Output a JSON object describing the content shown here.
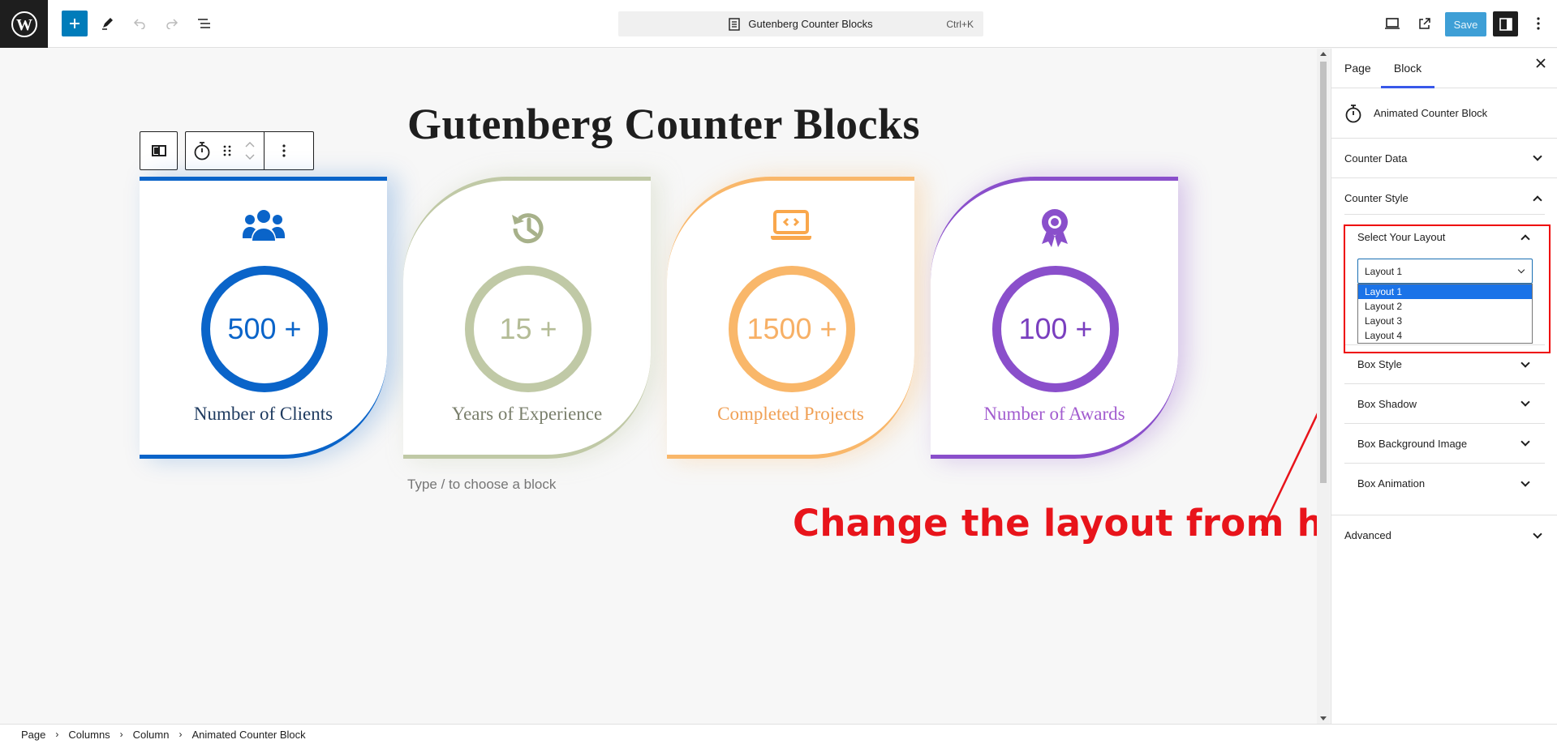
{
  "header": {
    "document_title": "Gutenberg Counter Blocks",
    "shortcut": "Ctrl+K",
    "save_label": "Save"
  },
  "canvas": {
    "title": "Gutenberg Counter Blocks",
    "placeholder": "Type / to choose a block",
    "annotation": "Change the layout from here"
  },
  "counters": [
    {
      "value": "500 +",
      "label": "Number of Clients",
      "color": "#0a64c9",
      "icon": "users-icon"
    },
    {
      "value": "15 +",
      "label": "Years of Experience",
      "color": "#c0c9a6",
      "icon": "history-icon"
    },
    {
      "value": "1500 +",
      "label": "Completed Projects",
      "color": "#f9b76a",
      "icon": "laptop-code-icon"
    },
    {
      "value": "100 +",
      "label": "Number of Awards",
      "color": "#8a4fcb",
      "icon": "award-icon"
    }
  ],
  "sidebar": {
    "tabs": [
      "Page",
      "Block"
    ],
    "active_tab": "Block",
    "block_name": "Animated Counter Block",
    "panels": {
      "counter_data": "Counter Data",
      "counter_style": "Counter Style",
      "select_layout": "Select Your Layout",
      "box_style": "Box Style",
      "box_shadow": "Box Shadow",
      "box_background_image": "Box Background Image",
      "box_animation": "Box Animation",
      "advanced": "Advanced"
    },
    "layout_select": {
      "selected": "Layout 1",
      "options": [
        "Layout 1",
        "Layout 2",
        "Layout 3",
        "Layout 4"
      ]
    }
  },
  "breadcrumb": [
    "Page",
    "Columns",
    "Column",
    "Animated Counter Block"
  ]
}
